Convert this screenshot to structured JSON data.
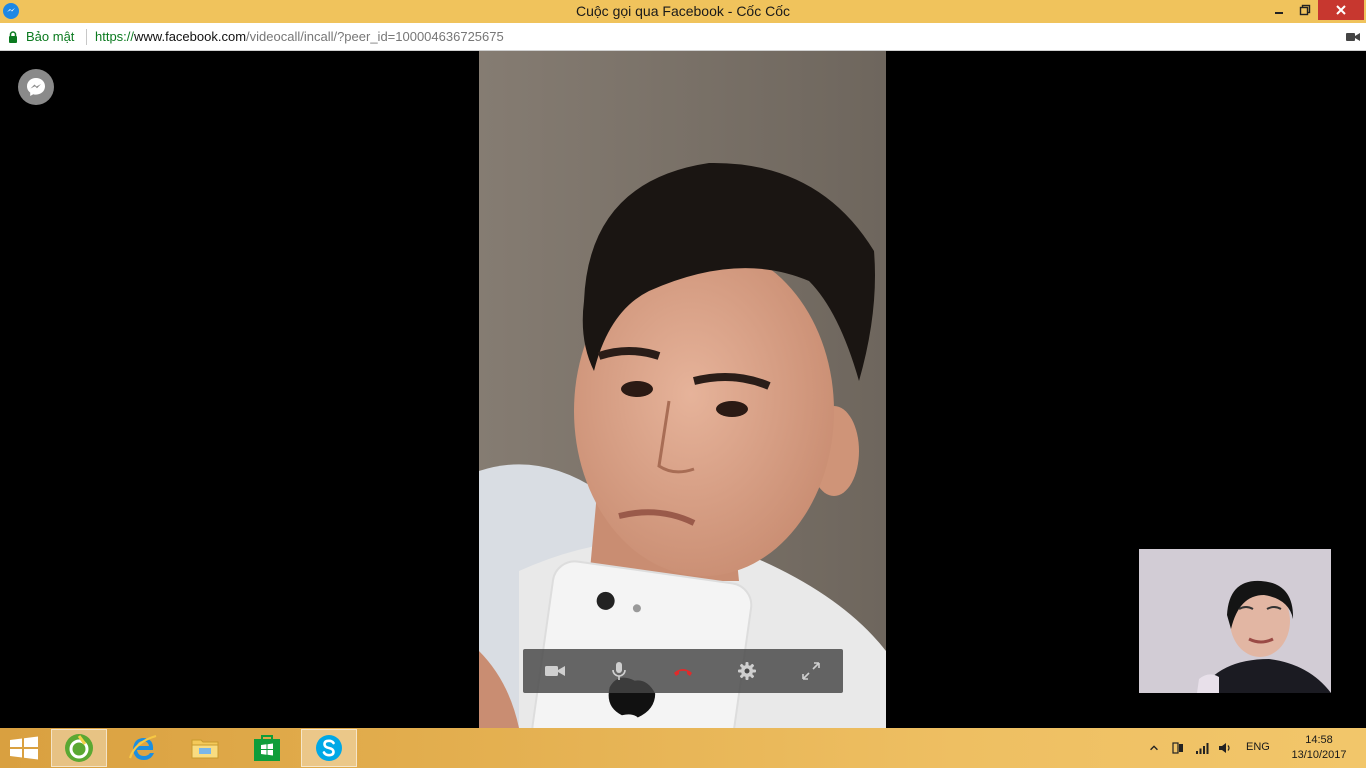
{
  "window": {
    "title": "Cuộc gọi qua Facebook - Cốc Cốc",
    "favicon": "messenger-icon",
    "controls": [
      "minimize-icon",
      "restore-icon",
      "close-icon"
    ]
  },
  "addressbar": {
    "secure_label": "Bảo mật",
    "url_prefix": "https://",
    "url_domain": "www.facebook.com",
    "url_path": "/videocall/incall/?peer_id=100004636725675",
    "right_icon": "camera-icon"
  },
  "call": {
    "brand_icon": "messenger-icon",
    "controls": [
      {
        "name": "video-toggle",
        "icon": "video-camera-icon"
      },
      {
        "name": "mute-toggle",
        "icon": "microphone-icon"
      },
      {
        "name": "end-call",
        "icon": "hang-up-icon",
        "color": "#e02b2b"
      },
      {
        "name": "settings",
        "icon": "gear-icon"
      },
      {
        "name": "fullscreen",
        "icon": "expand-icon"
      }
    ]
  },
  "taskbar": {
    "apps": [
      {
        "name": "coccoc",
        "icon": "coccoc-browser-icon",
        "active": true
      },
      {
        "name": "internet-explorer",
        "icon": "ie-icon",
        "active": false
      },
      {
        "name": "file-explorer",
        "icon": "folder-icon",
        "active": false
      },
      {
        "name": "store",
        "icon": "store-icon",
        "active": false
      },
      {
        "name": "skype",
        "icon": "skype-icon",
        "active": true
      }
    ],
    "tray": {
      "language": "ENG",
      "time": "14:58",
      "date": "13/10/2017"
    }
  },
  "colors": {
    "titlebar": "#f0c35c",
    "close_button": "#c7372f",
    "secure_green": "#0b7a1f",
    "hangup_red": "#e02b2b"
  }
}
